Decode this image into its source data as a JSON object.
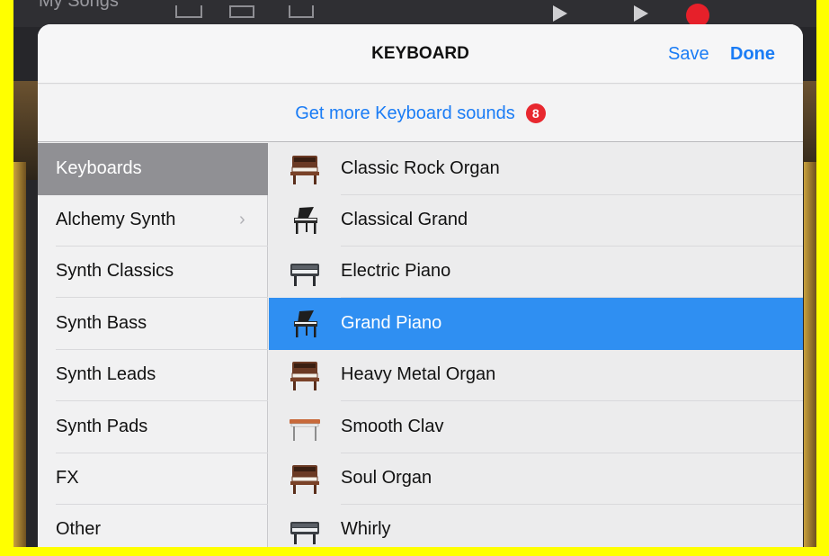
{
  "background": {
    "app_label": "My Songs",
    "record_color": "#e6202a"
  },
  "header": {
    "title": "KEYBOARD",
    "save_label": "Save",
    "done_label": "Done"
  },
  "more_sounds": {
    "label": "Get more Keyboard sounds",
    "badge_count": "8",
    "badge_color": "#e8282f"
  },
  "accent_color": "#1a7cf5",
  "selection_color": "#2f8ff2",
  "sidebar": {
    "items": [
      {
        "label": "Keyboards",
        "active": true
      },
      {
        "label": "Alchemy Synth",
        "has_submenu": true
      },
      {
        "label": "Synth Classics"
      },
      {
        "label": "Synth Bass"
      },
      {
        "label": "Synth Leads"
      },
      {
        "label": "Synth Pads"
      },
      {
        "label": "FX"
      },
      {
        "label": "Other"
      }
    ]
  },
  "sounds": {
    "items": [
      {
        "label": "Classic Rock Organ",
        "icon": "organ-icon"
      },
      {
        "label": "Classical Grand",
        "icon": "grand-piano-icon"
      },
      {
        "label": "Electric Piano",
        "icon": "electric-piano-icon"
      },
      {
        "label": "Grand Piano",
        "icon": "grand-piano-icon",
        "selected": true
      },
      {
        "label": "Heavy Metal Organ",
        "icon": "organ-icon"
      },
      {
        "label": "Smooth Clav",
        "icon": "clavinet-icon"
      },
      {
        "label": "Soul Organ",
        "icon": "organ-icon"
      },
      {
        "label": "Whirly",
        "icon": "electric-piano-icon"
      }
    ]
  }
}
